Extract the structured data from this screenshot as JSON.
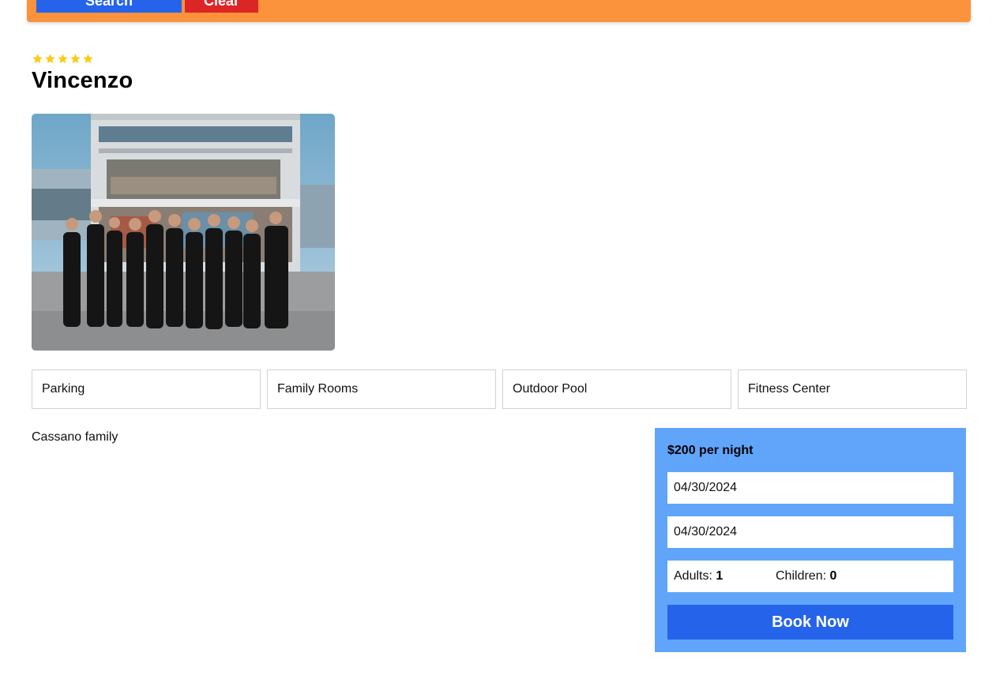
{
  "search": {
    "search_label": "Search",
    "clear_label": "Clear"
  },
  "hotel": {
    "star_rating": 5,
    "star_color": "#facc15",
    "name": "Vincenzo",
    "photo_alt": "Hotel photo",
    "description": "Cassano family"
  },
  "amenities": [
    "Parking",
    "Family Rooms",
    "Outdoor Pool",
    "Fitness Center"
  ],
  "booking": {
    "price": "$200 per night",
    "check_in": "04/30/2024",
    "check_out": "04/30/2024",
    "adults_label": "Adults:",
    "adults": "1",
    "children_label": "Children:",
    "children": "0",
    "book_label": "Book Now"
  },
  "colors": {
    "search_bar": "#fb923c",
    "search_button": "#2563eb",
    "clear_button": "#dc2626",
    "booking_panel": "#60a5fa",
    "book_button": "#2563eb"
  }
}
